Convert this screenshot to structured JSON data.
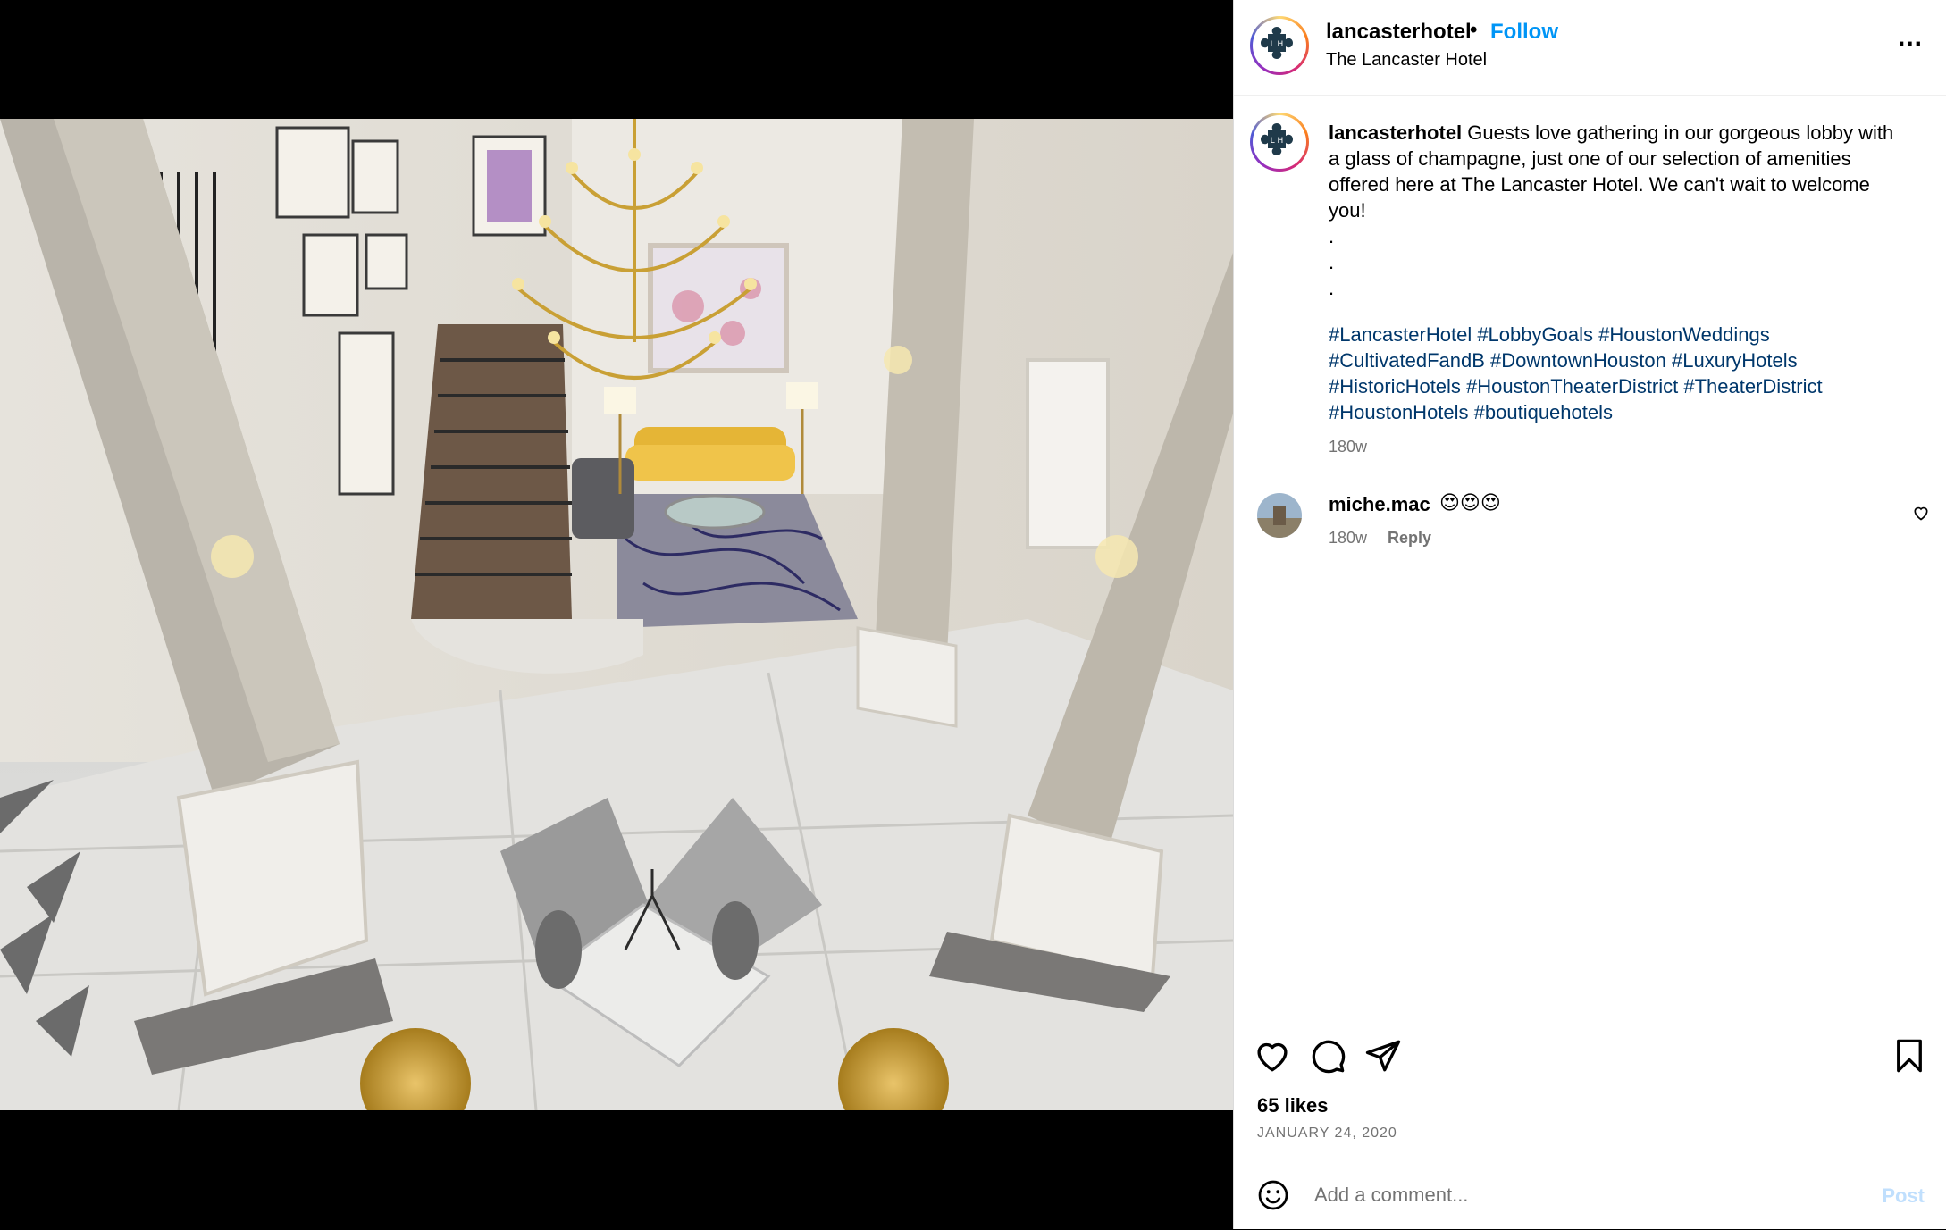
{
  "post": {
    "username": "lancasterhotel",
    "follow_label": "Follow",
    "separator": "•",
    "location": "The Lancaster Hotel",
    "more_label": "...",
    "caption_text": "Guests love gathering in our gorgeous lobby with a glass of champagne, just one of our selection of amenities offered here at The Lancaster Hotel. We can't wait to welcome you!",
    "caption_dots": [
      ".",
      ".",
      "."
    ],
    "hashtags": "#LancasterHotel #LobbyGoals #HoustonWeddings #CultivatedFandB #DowntownHouston #LuxuryHotels #HistoricHotels #HoustonTheaterDistrict #TheaterDistrict #HoustonHotels #boutiquehotels",
    "caption_age": "180w"
  },
  "comment": {
    "username": "miche.mac",
    "text": "😍😍😍",
    "age": "180w",
    "reply_label": "Reply"
  },
  "actions": {
    "likes": "65 likes",
    "date": "JANUARY 24, 2020"
  },
  "composer": {
    "placeholder": "Add a comment...",
    "post_label": "Post"
  },
  "icons": {
    "like": "heart-icon",
    "comment": "comment-bubble-icon",
    "share": "paper-plane-icon",
    "save": "bookmark-icon",
    "more": "more-options-icon",
    "emoji": "smiley-icon"
  },
  "colors": {
    "follow": "#0095f6",
    "hashtag": "#00376b",
    "muted": "#737373",
    "post_disabled": "#c0dffd"
  }
}
